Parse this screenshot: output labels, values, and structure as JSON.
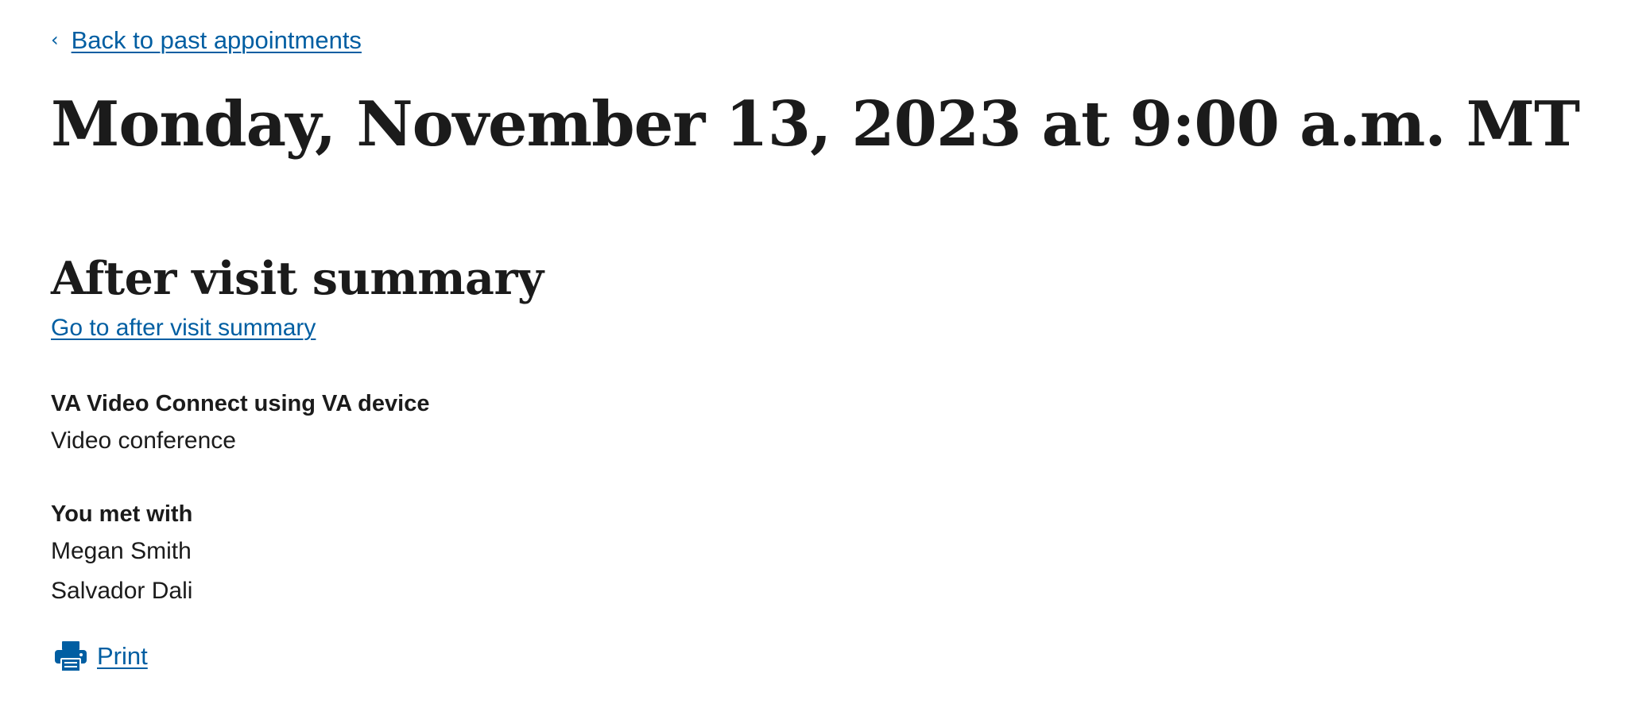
{
  "nav": {
    "back_chevron": "‹",
    "back_label": "Back to past appointments"
  },
  "appointment": {
    "datetime_heading": "Monday, November 13, 2023 at 9:00 a.m. MT"
  },
  "after_visit": {
    "heading": "After visit summary",
    "link_label": "Go to after visit summary"
  },
  "visit_type": {
    "label": "VA Video Connect using VA device",
    "value": "Video conference"
  },
  "met_with": {
    "label": "You met with",
    "people": [
      "Megan Smith",
      "Salvador Dali"
    ]
  },
  "actions": {
    "print_label": "Print",
    "print_icon": "printer-icon"
  },
  "colors": {
    "link": "#005ea2",
    "text": "#1b1b1b",
    "background": "#ffffff"
  }
}
